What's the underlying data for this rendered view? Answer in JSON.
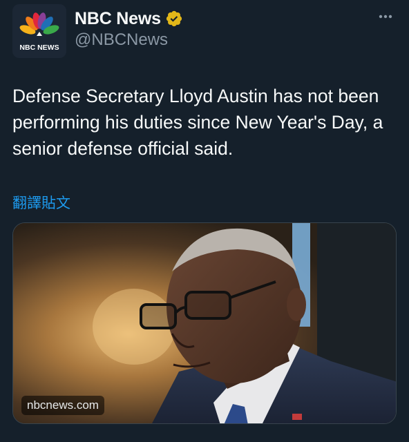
{
  "account": {
    "display_name": "NBC News",
    "handle": "@NBCNews",
    "avatar_label": "NBC NEWS",
    "verified_color": "#e2b719"
  },
  "menu": {
    "more_label": "···"
  },
  "tweet": {
    "text": "Defense Secretary Lloyd Austin has not been performing his duties since New Year's Day, a senior defense official said.",
    "translate_label": "翻譯貼文"
  },
  "media": {
    "source_label": "nbcnews.com"
  },
  "colors": {
    "background": "#15202b",
    "link": "#1d9bf0",
    "secondary_text": "#8b98a5"
  }
}
